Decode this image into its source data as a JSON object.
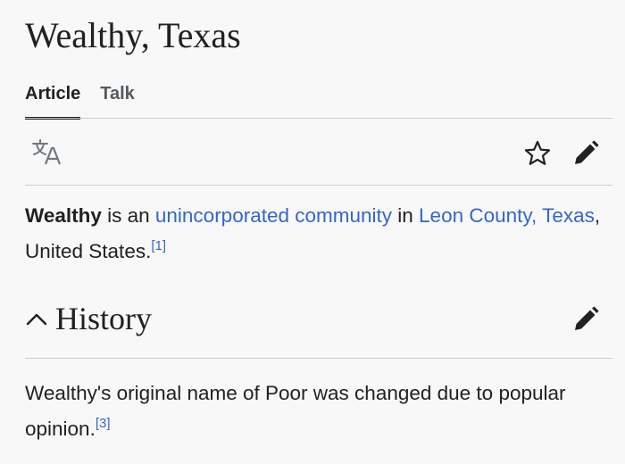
{
  "page": {
    "title": "Wealthy, Texas"
  },
  "tabs": [
    {
      "label": "Article",
      "active": true
    },
    {
      "label": "Talk",
      "active": false
    }
  ],
  "toolbar": {
    "language_icon": "translate-icon",
    "watch_icon": "star-icon",
    "edit_icon": "pencil-icon"
  },
  "intro": {
    "subject": "Wealthy",
    "text_1": " is an ",
    "link_1": "unincorporated community",
    "text_2": " in ",
    "link_2": "Leon County, Texas",
    "text_3": ", United States.",
    "ref": "[1]"
  },
  "history": {
    "heading": "History",
    "collapse_icon": "chevron-up-icon",
    "edit_icon": "pencil-icon",
    "text": "Wealthy's original name of Poor was changed due to popular opinion.",
    "ref": "[3]"
  },
  "colors": {
    "link": "#3366cc",
    "text": "#202122",
    "muted": "#54595d",
    "rule": "#c8ccd1",
    "background": "#f8f8f8"
  }
}
